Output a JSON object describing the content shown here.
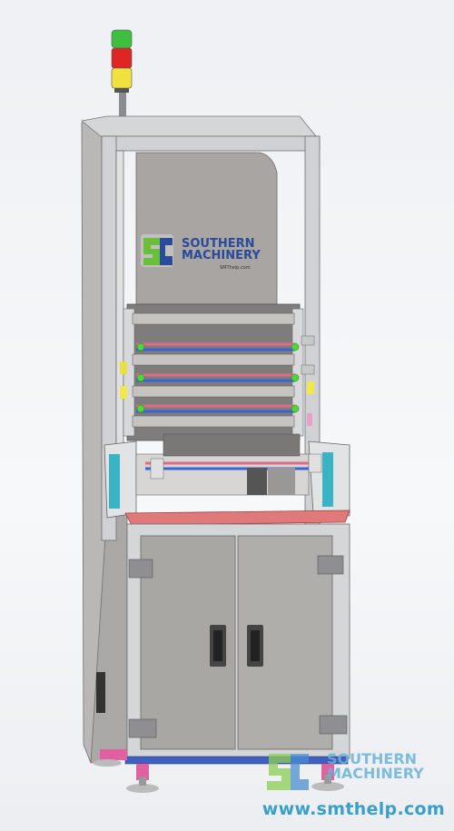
{
  "machine_logo": {
    "line1": "SOUTHERN",
    "line2": "MACHINERY",
    "url": "SMThelp.com"
  },
  "watermark": {
    "line1": "SOUTHERN",
    "line2": "MACHINERY",
    "url": "www.smthelp.com"
  },
  "colors": {
    "frame": "#c9cbce",
    "panel": "#a9a7a4",
    "accent_pink": "#e06a8a",
    "accent_blue": "#3a63d8",
    "watermark": "#3aa0c8",
    "logo_green": "#6abf3a",
    "logo_blue": "#2a4a9a"
  }
}
